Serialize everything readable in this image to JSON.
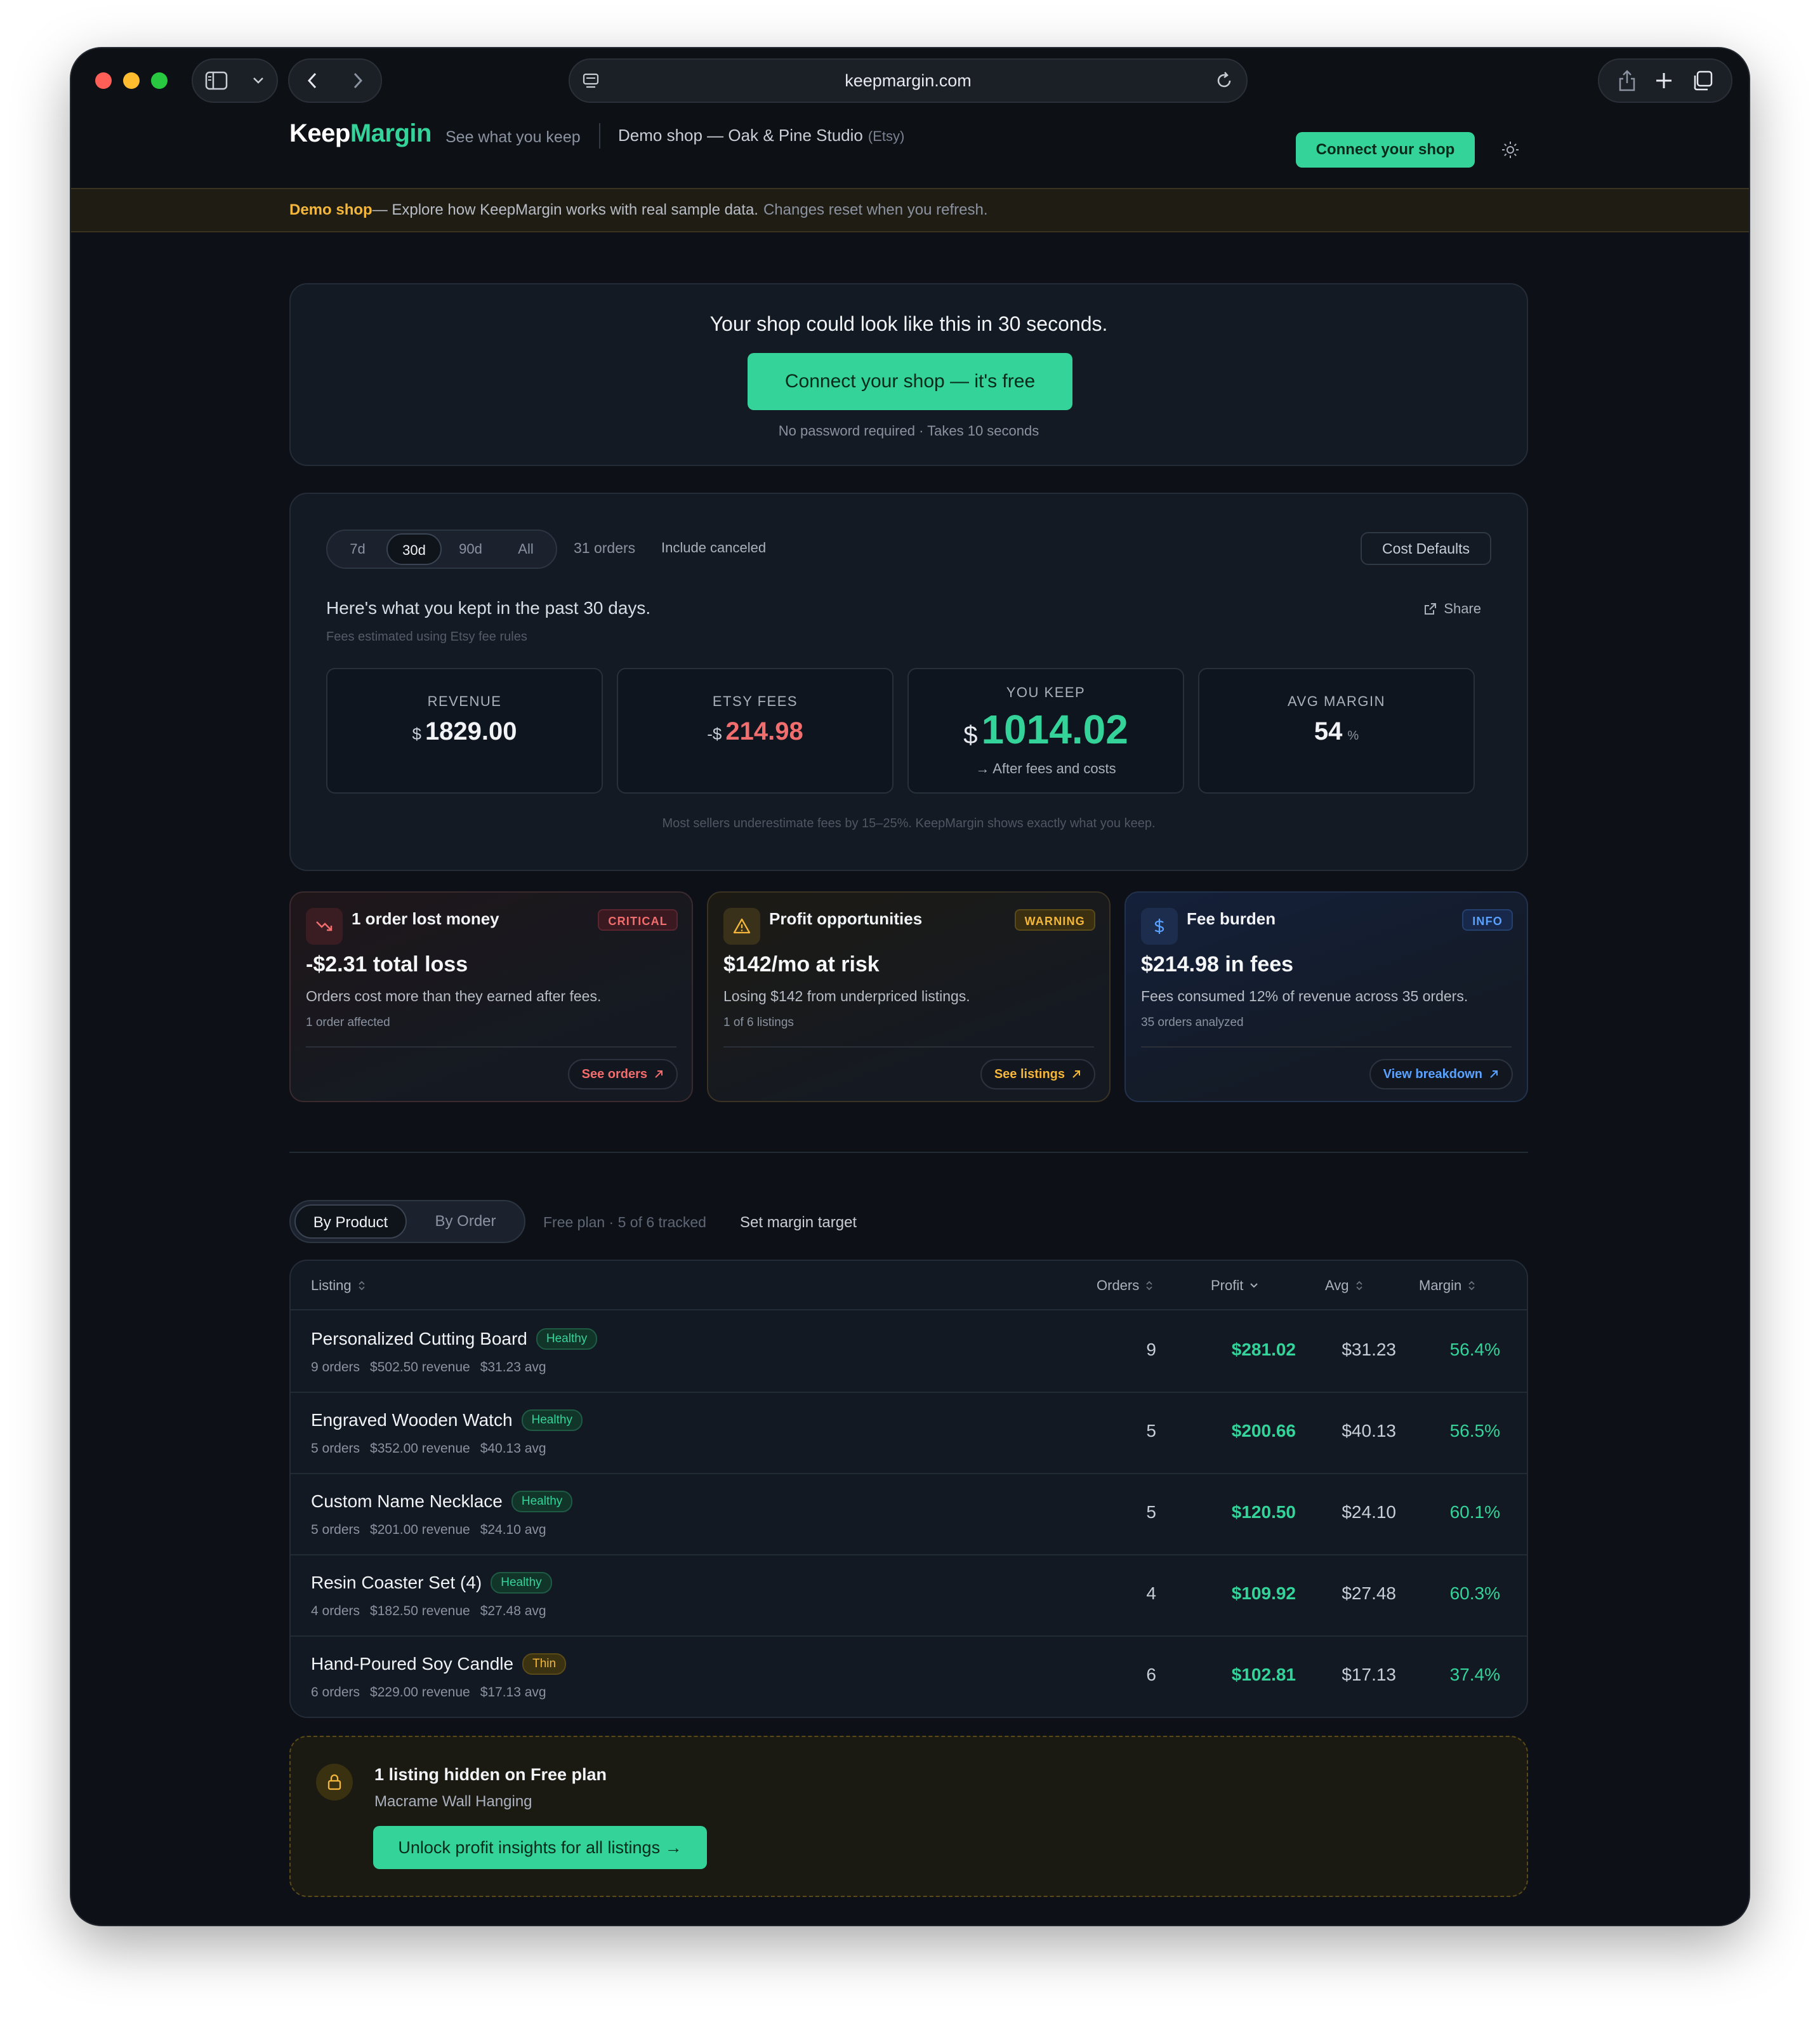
{
  "browser": {
    "url": "keepmargin.com"
  },
  "header": {
    "logo_main": "Keep",
    "logo_accent": "Margin",
    "tagline": "See what you keep",
    "shop_name": "Demo shop — Oak & Pine Studio",
    "platform": "(Etsy)",
    "connect_label": "Connect your shop"
  },
  "banner": {
    "highlight": "Demo shop",
    "text": " — Explore how KeepMargin works with real sample data.",
    "muted": "Changes reset when you refresh."
  },
  "cta": {
    "title": "Your shop could look like this in 30 seconds.",
    "button": "Connect your shop — it's free",
    "note": "No password required · Takes 10 seconds"
  },
  "summary": {
    "periods": [
      "7d",
      "30d",
      "90d",
      "All"
    ],
    "active_period": "30d",
    "orders_count": "31 orders",
    "include_canceled": "Include canceled",
    "cost_defaults": "Cost Defaults",
    "heading": "Here's what you kept in the past 30 days.",
    "sub": "Fees estimated using Etsy fee rules",
    "share": "Share",
    "note": "Most sellers underestimate fees by 15–25%. KeepMargin shows exactly what you keep.",
    "metrics": {
      "revenue": {
        "label": "REVENUE",
        "symbol": "$",
        "value": "1829.00"
      },
      "fees": {
        "label": "ETSY FEES",
        "symbol": "-$",
        "value": "214.98"
      },
      "keep": {
        "label": "YOU KEEP",
        "symbol": "$",
        "value": "1014.02",
        "foot": "→ After fees and costs"
      },
      "margin": {
        "label": "AVG MARGIN",
        "value": "54",
        "unit": "%"
      }
    }
  },
  "alerts": [
    {
      "title": "1 order lost money",
      "badge": "CRITICAL",
      "main": "-$2.31 total loss",
      "desc": "Orders cost more than they earned after fees.",
      "meta": "1 order affected",
      "link": "See orders"
    },
    {
      "title": "Profit opportunities",
      "badge": "WARNING",
      "main": "$142/mo at risk",
      "desc": "Losing $142 from underpriced listings.",
      "meta": "1 of 6 listings",
      "link": "See listings"
    },
    {
      "title": "Fee burden",
      "badge": "INFO",
      "main": "$214.98 in fees",
      "desc": "Fees consumed 12% of revenue across 35 orders.",
      "meta": "35 orders analyzed",
      "link": "View breakdown"
    }
  ],
  "listing_view": {
    "tabs": [
      "By Product",
      "By Order"
    ],
    "plan_note": "Free plan · 5 of 6 tracked",
    "margin_target": "Set margin target"
  },
  "table": {
    "headers": {
      "listing": "Listing",
      "orders": "Orders",
      "profit": "Profit",
      "avg": "Avg",
      "margin": "Margin"
    },
    "rows": [
      {
        "name": "Personalized Cutting Board",
        "status": "Healthy",
        "orders_sub": "9 orders",
        "revenue_sub": "$502.50 revenue",
        "avg_sub": "$31.23 avg",
        "orders": "9",
        "profit": "$281.02",
        "avg": "$31.23",
        "margin": "56.4%"
      },
      {
        "name": "Engraved Wooden Watch",
        "status": "Healthy",
        "orders_sub": "5 orders",
        "revenue_sub": "$352.00 revenue",
        "avg_sub": "$40.13 avg",
        "orders": "5",
        "profit": "$200.66",
        "avg": "$40.13",
        "margin": "56.5%"
      },
      {
        "name": "Custom Name Necklace",
        "status": "Healthy",
        "orders_sub": "5 orders",
        "revenue_sub": "$201.00 revenue",
        "avg_sub": "$24.10 avg",
        "orders": "5",
        "profit": "$120.50",
        "avg": "$24.10",
        "margin": "60.1%"
      },
      {
        "name": "Resin Coaster Set (4)",
        "status": "Healthy",
        "orders_sub": "4 orders",
        "revenue_sub": "$182.50 revenue",
        "avg_sub": "$27.48 avg",
        "orders": "4",
        "profit": "$109.92",
        "avg": "$27.48",
        "margin": "60.3%"
      },
      {
        "name": "Hand-Poured Soy Candle",
        "status": "Thin",
        "orders_sub": "6 orders",
        "revenue_sub": "$229.00 revenue",
        "avg_sub": "$17.13 avg",
        "orders": "6",
        "profit": "$102.81",
        "avg": "$17.13",
        "margin": "37.4%"
      }
    ]
  },
  "hidden": {
    "title": "1 listing hidden on Free plan",
    "listing": "Macrame Wall Hanging",
    "button": "Unlock profit insights for all listings →"
  },
  "colors": {
    "accent": "#34d399",
    "critical": "#f26d6d",
    "warning": "#f5b73b",
    "info": "#5aa2ff",
    "background": "#0d1117"
  }
}
